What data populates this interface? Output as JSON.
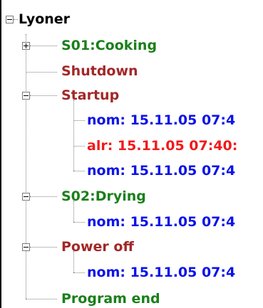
{
  "tree": {
    "root": {
      "label": "Lyoner",
      "expanded": true
    },
    "items": [
      {
        "label": "S01:Cooking",
        "expanded": false
      },
      {
        "label": "Shutdown"
      },
      {
        "label": "Startup",
        "expanded": true,
        "children": [
          {
            "label": "nom: 15.11.05 07:4"
          },
          {
            "label": "alr: 15.11.05 07:40:"
          },
          {
            "label": "nom: 15.11.05 07:4"
          }
        ]
      },
      {
        "label": "S02:Drying",
        "expanded": true,
        "children": [
          {
            "label": "nom: 15.11.05 07:4"
          }
        ]
      },
      {
        "label": "Power off",
        "expanded": true,
        "children": [
          {
            "label": "nom: 15.11.05 07:4"
          }
        ]
      },
      {
        "label": "Program end"
      }
    ]
  },
  "colors": {
    "root": "#000000",
    "step_green": "#1a7f1a",
    "step_dark_red": "#a32727",
    "entry_blue": "#0b13e8",
    "alarm_red": "#f11a1a"
  }
}
